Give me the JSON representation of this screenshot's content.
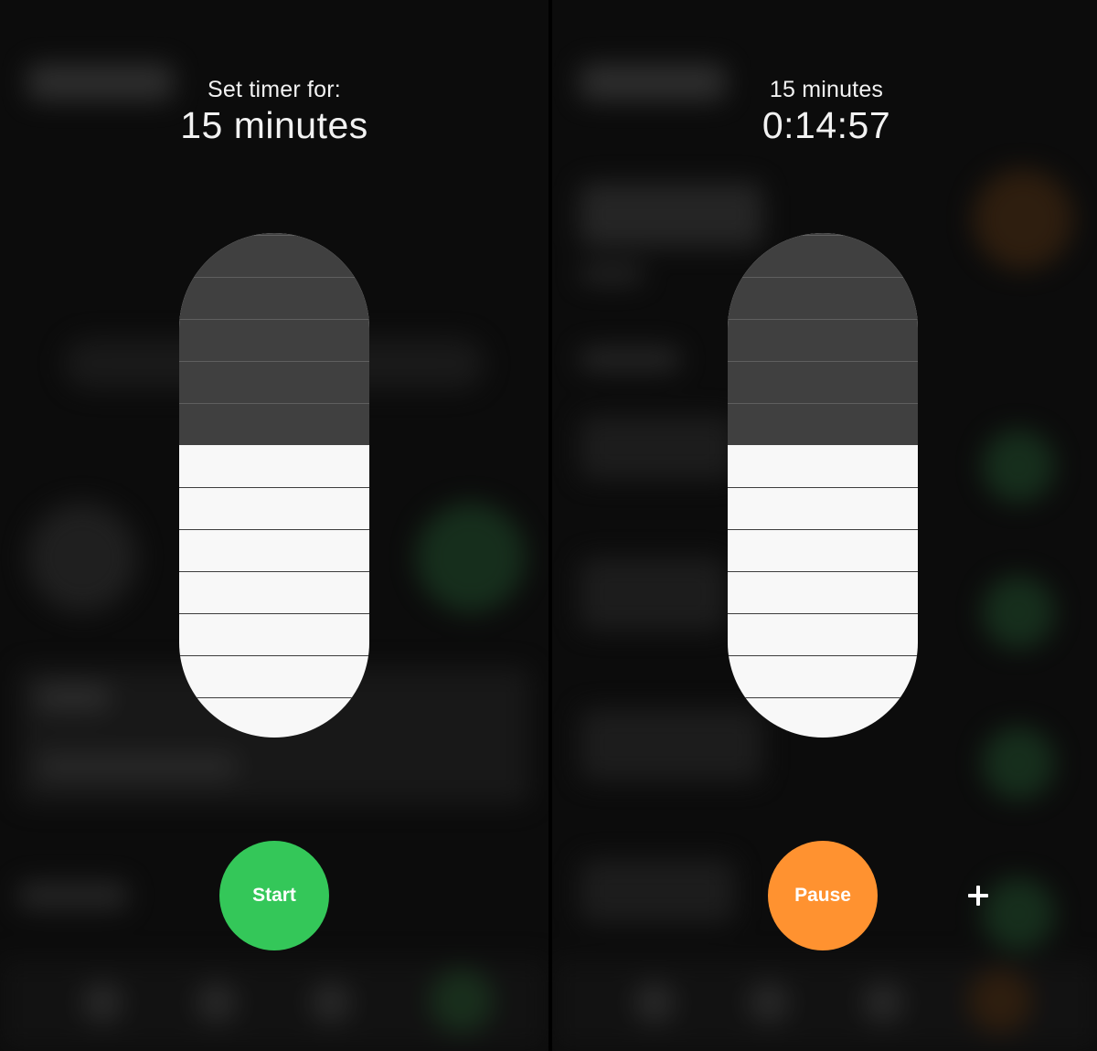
{
  "start_panel": {
    "caption": "Set timer for:",
    "duration": "15 minutes",
    "fill_fraction": 0.58,
    "button_label": "Start",
    "button_color": "#34C759"
  },
  "running_panel": {
    "caption": "15 minutes",
    "remaining": "0:14:57",
    "fill_fraction": 0.58,
    "button_label": "Pause",
    "button_color": "#FF9230",
    "add_icon": "plus-icon"
  },
  "colors": {
    "slider_filled": "#F8F8F8",
    "slider_empty": "#404040",
    "background": "#0C0C0C"
  }
}
